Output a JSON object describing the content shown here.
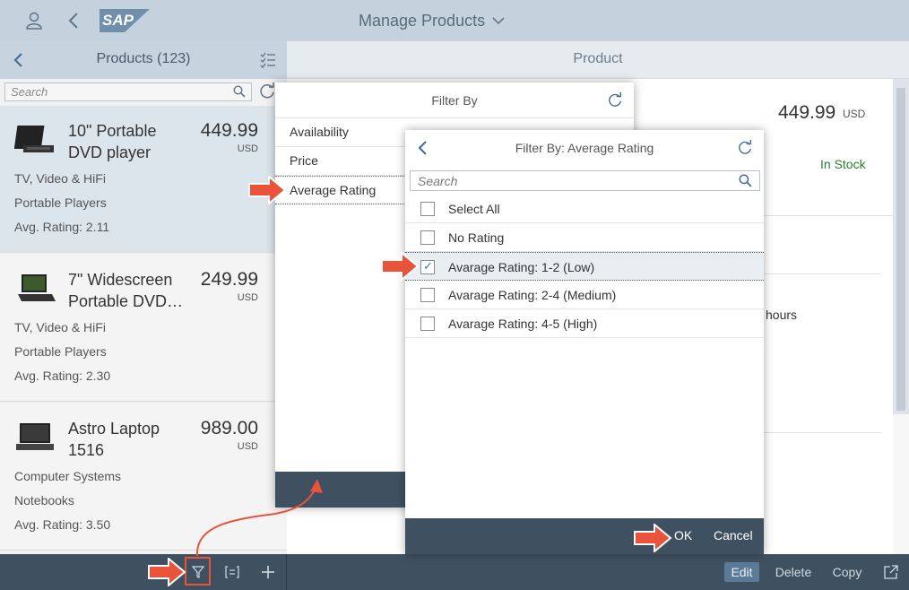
{
  "shell": {
    "logo_text": "SAP",
    "app_title": "Manage Products"
  },
  "master": {
    "title": "Products (123)",
    "search_placeholder": "Search",
    "items": [
      {
        "name": "10\" Portable DVD player",
        "price": "449.99",
        "currency": "USD",
        "category": "TV, Video & HiFi",
        "subcategory": "Portable Players",
        "rating": "Avg. Rating: 2.11"
      },
      {
        "name": "7\" Widescreen Portable DVD…",
        "price": "249.99",
        "currency": "USD",
        "category": "TV, Video & HiFi",
        "subcategory": "Portable Players",
        "rating": "Avg. Rating: 2.30"
      },
      {
        "name": "Astro Laptop 1516",
        "price": "989.00",
        "currency": "USD",
        "category": "Computer Systems",
        "subcategory": "Notebooks",
        "rating": "Avg. Rating: 3.50"
      }
    ]
  },
  "detail": {
    "title": "Product",
    "price": "449.99",
    "currency": "USD",
    "stock": "In Stock",
    "hours_text": "hours"
  },
  "filter_dialog": {
    "title": "Filter By",
    "items": [
      "Availability",
      "Price",
      "Average Rating"
    ]
  },
  "rating_dialog": {
    "title": "Filter By: Average Rating",
    "search_placeholder": "Search",
    "options": [
      {
        "label": "Select All",
        "checked": false
      },
      {
        "label": "No Rating",
        "checked": false
      },
      {
        "label": "Avarage Rating: 1-2 (Low)",
        "checked": true
      },
      {
        "label": "Avarage Rating: 2-4 (Medium)",
        "checked": false
      },
      {
        "label": "Avarage Rating: 4-5 (High)",
        "checked": false
      }
    ],
    "ok_label": "OK",
    "cancel_label": "Cancel"
  },
  "footer": {
    "edit": "Edit",
    "delete": "Delete",
    "copy": "Copy"
  },
  "colors": {
    "accent_arrow": "#e8533a",
    "footer_bg": "#3f5161",
    "shell_bg": "#c4d2de",
    "stock_green": "#2b7c2b"
  }
}
